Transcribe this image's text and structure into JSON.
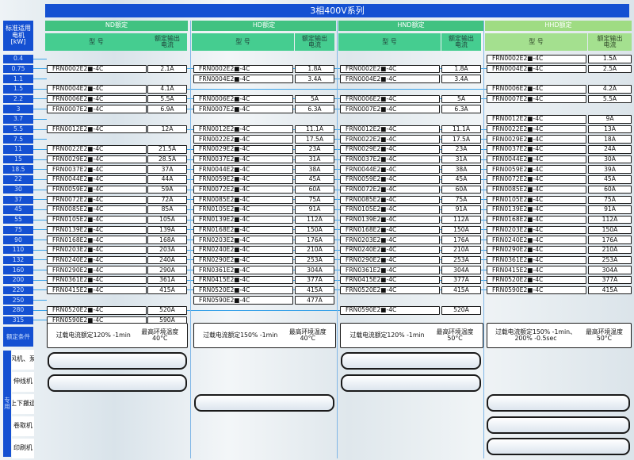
{
  "series_title": "3相400V系列",
  "header_left": [
    "标准适用",
    "电机",
    "[kW]"
  ],
  "groups": [
    {
      "name": "ND额定",
      "model_header": "型 号",
      "current_header": [
        "额定输出",
        "电流"
      ]
    },
    {
      "name": "HD额定",
      "model_header": "型 号",
      "current_header": [
        "额定输出",
        "电流"
      ]
    },
    {
      "name": "HND额定",
      "model_header": "型 号",
      "current_header": [
        "额定输出",
        "电流"
      ]
    },
    {
      "name": "HHD额定",
      "model_header": "型 号",
      "current_header": [
        "额定输出",
        "电流"
      ]
    }
  ],
  "kw": [
    "0.4",
    "0.75",
    "1.1",
    "1.5",
    "2.2",
    "3",
    "3.7",
    "5.5",
    "7.5",
    "11",
    "15",
    "18.5",
    "22",
    "30",
    "37",
    "45",
    "55",
    "75",
    "90",
    "110",
    "132",
    "160",
    "200",
    "220",
    "250",
    "280",
    "315"
  ],
  "table": {
    "ND": [
      [
        null,
        null
      ],
      [
        "FRN0002E2■-4C",
        "2.1A"
      ],
      [
        null,
        null
      ],
      [
        "FRN0004E2■-4C",
        "4.1A"
      ],
      [
        "FRN0006E2■-4C",
        "5.5A"
      ],
      [
        "FRN0007E2■-4C",
        "6.9A"
      ],
      [
        null,
        null
      ],
      [
        "FRN0012E2■-4C",
        "12A"
      ],
      [
        null,
        null
      ],
      [
        "FRN0022E2■-4C",
        "21.5A"
      ],
      [
        "FRN0029E2■-4C",
        "28.5A"
      ],
      [
        "FRN0037E2■-4C",
        "37A"
      ],
      [
        "FRN0044E2■-4C",
        "44A"
      ],
      [
        "FRN0059E2■-4C",
        "59A"
      ],
      [
        "FRN0072E2■-4C",
        "72A"
      ],
      [
        "FRN0085E2■-4C",
        "85A"
      ],
      [
        "FRN0105E2■-4C",
        "105A"
      ],
      [
        "FRN0139E2■-4C",
        "139A"
      ],
      [
        "FRN0168E2■-4C",
        "168A"
      ],
      [
        "FRN0203E2■-4C",
        "203A"
      ],
      [
        "FRN0240E2■-4C",
        "240A"
      ],
      [
        "FRN0290E2■-4C",
        "290A"
      ],
      [
        "FRN0361E2■-4C",
        "361A"
      ],
      [
        "FRN0415E2■-4C",
        "415A"
      ],
      [
        null,
        null
      ],
      [
        "FRN0520E2■-4C",
        "520A"
      ],
      [
        "FRN0590E2■-4C",
        "590A"
      ]
    ],
    "HD": [
      [
        null,
        null
      ],
      [
        "FRN0002E2■-4C",
        "1.8A"
      ],
      [
        "FRN0004E2■-4C",
        "3.4A"
      ],
      [
        null,
        null
      ],
      [
        "FRN0006E2■-4C",
        "5A"
      ],
      [
        "FRN0007E2■-4C",
        "6.3A"
      ],
      [
        null,
        null
      ],
      [
        "FRN0012E2■-4C",
        "11.1A"
      ],
      [
        "FRN0022E2■-4C",
        "17.5A"
      ],
      [
        "FRN0029E2■-4C",
        "23A"
      ],
      [
        "FRN0037E2■-4C",
        "31A"
      ],
      [
        "FRN0044E2■-4C",
        "38A"
      ],
      [
        "FRN0059E2■-4C",
        "45A"
      ],
      [
        "FRN0072E2■-4C",
        "60A"
      ],
      [
        "FRN0085E2■-4C",
        "75A"
      ],
      [
        "FRN0105E2■-4C",
        "91A"
      ],
      [
        "FRN0139E2■-4C",
        "112A"
      ],
      [
        "FRN0168E2■-4C",
        "150A"
      ],
      [
        "FRN0203E2■-4C",
        "176A"
      ],
      [
        "FRN0240E2■-4C",
        "210A"
      ],
      [
        "FRN0290E2■-4C",
        "253A"
      ],
      [
        "FRN0361E2■-4C",
        "304A"
      ],
      [
        "FRN0415E2■-4C",
        "377A"
      ],
      [
        "FRN0520E2■-4C",
        "415A"
      ],
      [
        "FRN0590E2■-4C",
        "477A"
      ],
      [
        null,
        null
      ],
      [
        null,
        null
      ]
    ],
    "HND": [
      [
        null,
        null
      ],
      [
        "FRN0002E2■-4C",
        "1.8A"
      ],
      [
        "FRN0004E2■-4C",
        "3.4A"
      ],
      [
        null,
        null
      ],
      [
        "FRN0006E2■-4C",
        "5A"
      ],
      [
        "FRN0007E2■-4C",
        "6.3A"
      ],
      [
        null,
        null
      ],
      [
        "FRN0012E2■-4C",
        "11.1A"
      ],
      [
        "FRN0022E2■-4C",
        "17.5A"
      ],
      [
        "FRN0029E2■-4C",
        "23A"
      ],
      [
        "FRN0037E2■-4C",
        "31A"
      ],
      [
        "FRN0044E2■-4C",
        "38A"
      ],
      [
        "FRN0059E2■-4C",
        "45A"
      ],
      [
        "FRN0072E2■-4C",
        "60A"
      ],
      [
        "FRN0085E2■-4C",
        "75A"
      ],
      [
        "FRN0105E2■-4C",
        "91A"
      ],
      [
        "FRN0139E2■-4C",
        "112A"
      ],
      [
        "FRN0168E2■-4C",
        "150A"
      ],
      [
        "FRN0203E2■-4C",
        "176A"
      ],
      [
        "FRN0240E2■-4C",
        "210A"
      ],
      [
        "FRN0290E2■-4C",
        "253A"
      ],
      [
        "FRN0361E2■-4C",
        "304A"
      ],
      [
        "FRN0415E2■-4C",
        "377A"
      ],
      [
        "FRN0520E2■-4C",
        "415A"
      ],
      [
        null,
        null
      ],
      [
        "FRN0590E2■-4C",
        "520A"
      ],
      [
        null,
        null
      ]
    ],
    "HHD": [
      [
        "FRN0002E2■-4C",
        "1.5A"
      ],
      [
        "FRN0004E2■-4C",
        "2.5A"
      ],
      [
        null,
        null
      ],
      [
        "FRN0006E2■-4C",
        "4.2A"
      ],
      [
        "FRN0007E2■-4C",
        "5.5A"
      ],
      [
        null,
        null
      ],
      [
        "FRN0012E2■-4C",
        "9A"
      ],
      [
        "FRN0022E2■-4C",
        "13A"
      ],
      [
        "FRN0029E2■-4C",
        "18A"
      ],
      [
        "FRN0037E2■-4C",
        "24A"
      ],
      [
        "FRN0044E2■-4C",
        "30A"
      ],
      [
        "FRN0059E2■-4C",
        "39A"
      ],
      [
        "FRN0072E2■-4C",
        "45A"
      ],
      [
        "FRN0085E2■-4C",
        "60A"
      ],
      [
        "FRN0105E2■-4C",
        "75A"
      ],
      [
        "FRN0139E2■-4C",
        "91A"
      ],
      [
        "FRN0168E2■-4C",
        "112A"
      ],
      [
        "FRN0203E2■-4C",
        "150A"
      ],
      [
        "FRN0240E2■-4C",
        "176A"
      ],
      [
        "FRN0290E2■-4C",
        "210A"
      ],
      [
        "FRN0361E2■-4C",
        "253A"
      ],
      [
        "FRN0415E2■-4C",
        "304A"
      ],
      [
        "FRN0520E2■-4C",
        "377A"
      ],
      [
        "FRN0590E2■-4C",
        "415A"
      ],
      [
        null,
        null
      ],
      [
        null,
        null
      ],
      [
        null,
        null
      ]
    ]
  },
  "conditions_label": "额定条件",
  "conditions": [
    {
      "overload": "过载电流额定120% -1min",
      "temp": [
        "最高环境温度",
        "40°C"
      ]
    },
    {
      "overload": "过载电流额定150% -1min",
      "temp": [
        "最高环境温度",
        "40°C"
      ]
    },
    {
      "overload": "过载电流额定120% -1min",
      "temp": [
        "最高环境温度",
        "50°C"
      ]
    },
    {
      "overload": "过载电流额定150% -1min、",
      "overload2": "200% -0.5sec",
      "temp": [
        "最高环境温度",
        "50°C"
      ]
    }
  ],
  "applications": [
    "风机、泵",
    "伸线机",
    "上下搬运",
    "卷取机",
    "印刷机"
  ],
  "application_side_label": "专\n用"
}
